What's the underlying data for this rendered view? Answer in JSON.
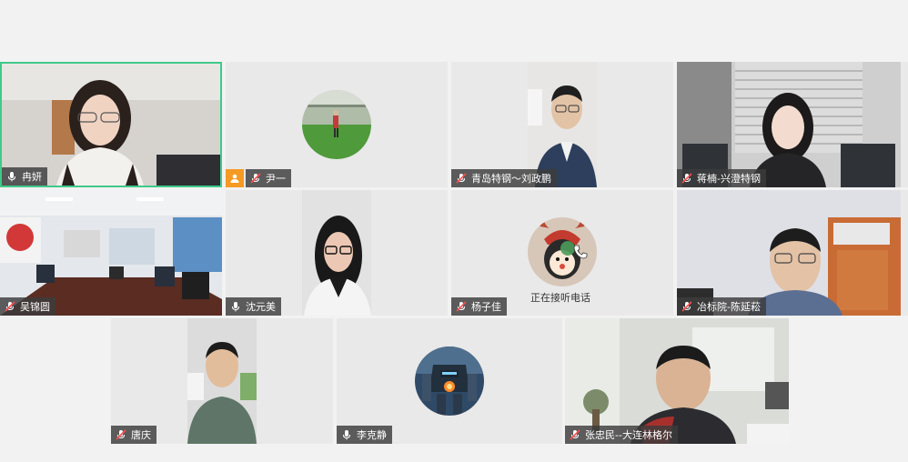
{
  "colors": {
    "active_border": "#3fc98a",
    "host_badge": "#f59a23",
    "muted_icon": "#ff4d4f",
    "background": "#f2f2f2"
  },
  "participants": [
    {
      "name": "冉妍",
      "mic": "on",
      "video": true,
      "active": true
    },
    {
      "name": "尹一",
      "mic": "muted",
      "video": false,
      "host": true,
      "avatar_icon": "soccer-field-avatar-icon"
    },
    {
      "name": "青岛特钢～刘政鹏",
      "mic": "muted",
      "video": true
    },
    {
      "name": "蒋楠-兴澄特钢",
      "mic": "muted",
      "video": true
    },
    {
      "name": "吴锦圆",
      "mic": "muted",
      "video": true
    },
    {
      "name": "沈元美",
      "mic": "on",
      "video": true
    },
    {
      "name": "杨子佳",
      "mic": "muted",
      "video": false,
      "avatar_icon": "cartoon-reindeer-avatar-icon",
      "status": "正在接听电话"
    },
    {
      "name": "冶标院-陈延菘",
      "mic": "muted",
      "video": true
    },
    {
      "name": "唐庆",
      "mic": "muted",
      "video": true
    },
    {
      "name": "李克静",
      "mic": "on",
      "video": false,
      "avatar_icon": "robot-mech-avatar-icon"
    },
    {
      "name": "张忠民--大连林格尔",
      "mic": "muted",
      "video": true
    }
  ]
}
